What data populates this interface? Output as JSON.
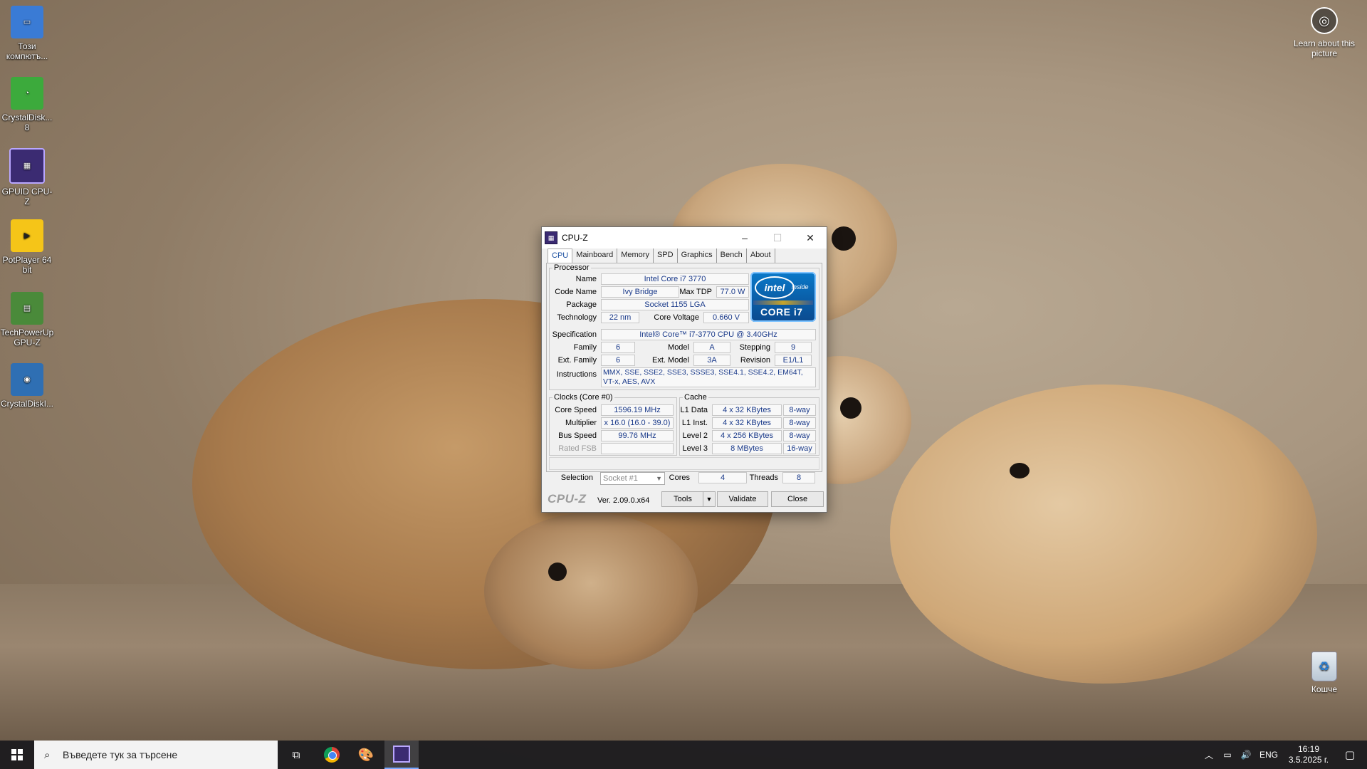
{
  "desktop": {
    "icons": [
      {
        "label": "Този компютъ...",
        "icon": "computer-icon",
        "color": "#3a7bd5"
      },
      {
        "label": "CrystalDisk... 8",
        "icon": "crystaldiskinfo-icon",
        "color": "#3caa3c"
      },
      {
        "label": "GPUID CPU-Z",
        "icon": "cpuz-icon",
        "color": "#3b2b72"
      },
      {
        "label": "PotPlayer 64 bit",
        "icon": "potplayer-icon",
        "color": "#f5c518"
      },
      {
        "label": "TechPowerUp GPU-Z",
        "icon": "gpuz-icon",
        "color": "#4a8a3a"
      },
      {
        "label": "CrystalDiskI...",
        "icon": "crystaldiskmark-icon",
        "color": "#2f6fb3"
      }
    ],
    "learn_picture": "Learn about this picture",
    "recycle_bin": "Кошче"
  },
  "window": {
    "title": "CPU-Z",
    "tabs": [
      "CPU",
      "Mainboard",
      "Memory",
      "SPD",
      "Graphics",
      "Bench",
      "About"
    ],
    "active_tab": "CPU",
    "processor": {
      "legend": "Processor",
      "name_label": "Name",
      "name": "Intel Core i7 3770",
      "codename_label": "Code Name",
      "codename": "Ivy Bridge",
      "maxtdp_label": "Max TDP",
      "maxtdp": "77.0 W",
      "package_label": "Package",
      "package": "Socket 1155 LGA",
      "technology_label": "Technology",
      "technology": "22 nm",
      "corevoltage_label": "Core Voltage",
      "corevoltage": "0.660 V",
      "spec_label": "Specification",
      "spec": "Intel® Core™ i7-3770 CPU @ 3.40GHz",
      "family_label": "Family",
      "family": "6",
      "model_label": "Model",
      "model": "A",
      "stepping_label": "Stepping",
      "stepping": "9",
      "extfamily_label": "Ext. Family",
      "extfamily": "6",
      "extmodel_label": "Ext. Model",
      "extmodel": "3A",
      "revision_label": "Revision",
      "revision": "E1/L1",
      "instructions_label": "Instructions",
      "instructions": "MMX, SSE, SSE2, SSE3, SSSE3, SSE4.1, SSE4.2, EM64T, VT-x, AES, AVX",
      "logo": {
        "brand": "intel",
        "inside": "inside",
        "line": "CORE i7"
      }
    },
    "clocks": {
      "legend": "Clocks (Core #0)",
      "corespeed_label": "Core Speed",
      "corespeed": "1596.19 MHz",
      "multiplier_label": "Multiplier",
      "multiplier": "x 16.0 (16.0 - 39.0)",
      "busspeed_label": "Bus Speed",
      "busspeed": "99.76 MHz",
      "ratedfsb_label": "Rated FSB",
      "ratedfsb": ""
    },
    "cache": {
      "legend": "Cache",
      "l1data_label": "L1 Data",
      "l1data": "4 x 32 KBytes",
      "l1data_way": "8-way",
      "l1inst_label": "L1 Inst.",
      "l1inst": "4 x 32 KBytes",
      "l1inst_way": "8-way",
      "l2_label": "Level 2",
      "l2": "4 x 256 KBytes",
      "l2_way": "8-way",
      "l3_label": "Level 3",
      "l3": "8 MBytes",
      "l3_way": "16-way"
    },
    "selection": {
      "label": "Selection",
      "value": "Socket #1",
      "cores_label": "Cores",
      "cores": "4",
      "threads_label": "Threads",
      "threads": "8"
    },
    "footer": {
      "brand": "CPU-Z",
      "version": "Ver. 2.09.0.x64",
      "tools": "Tools",
      "validate": "Validate",
      "close": "Close"
    }
  },
  "taskbar": {
    "search_placeholder": "Въведете тук за търсене",
    "language": "ENG",
    "time": "16:19",
    "date": "3.5.2025 г."
  }
}
